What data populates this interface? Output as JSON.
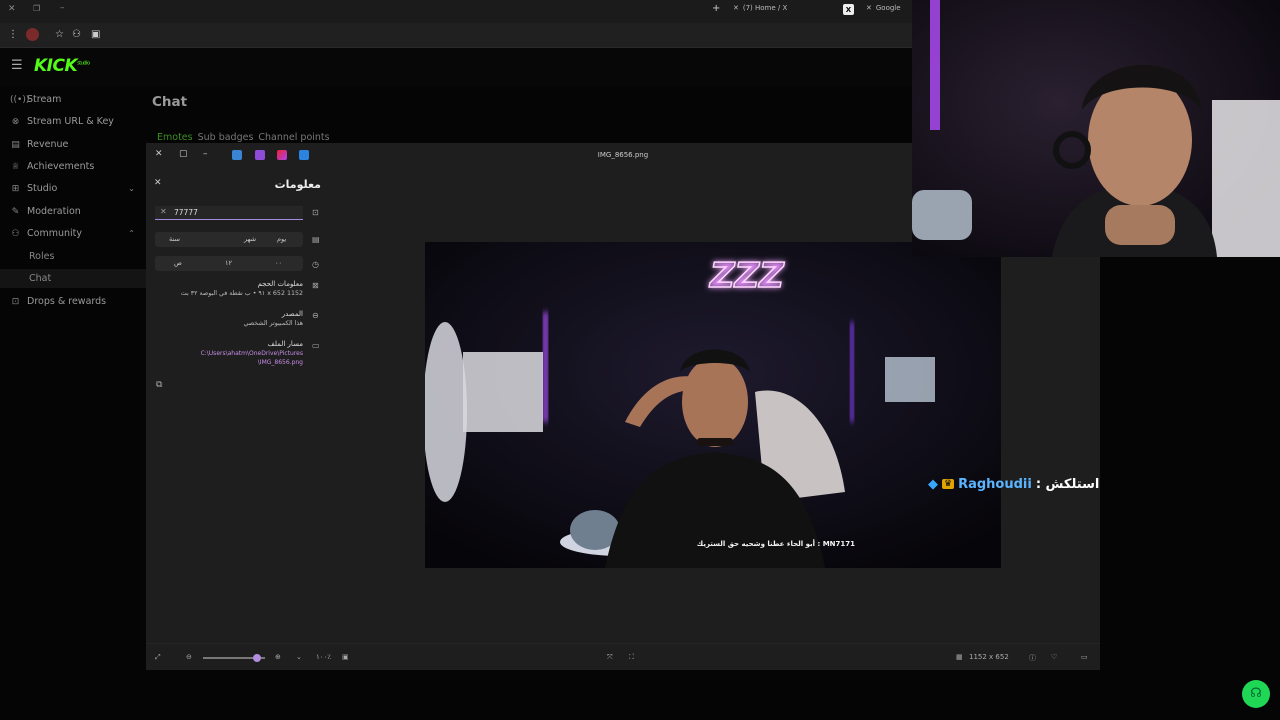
{
  "browser": {
    "tabs": [
      {
        "label": "(7) Home / X",
        "icon": "x-logo-icon"
      },
      {
        "label": "Google",
        "icon": "x-logo-icon"
      }
    ],
    "new_tab_label": "+"
  },
  "kick": {
    "logo": "KICK",
    "logo_badge": "studio",
    "nav": [
      {
        "label": "Stream",
        "icon": "stream-icon"
      },
      {
        "label": "Stream URL & Key",
        "icon": "key-icon"
      },
      {
        "label": "Revenue",
        "icon": "revenue-icon"
      },
      {
        "label": "Achievements",
        "icon": "trophy-icon"
      },
      {
        "label": "Studio",
        "icon": "studio-icon"
      },
      {
        "label": "Moderation",
        "icon": "wrench-icon"
      },
      {
        "label": "Community",
        "icon": "community-icon"
      },
      {
        "label": "Drops & rewards",
        "icon": "gift-icon"
      }
    ],
    "community_sub": [
      "Roles",
      "Chat"
    ],
    "page_title": "Chat",
    "chat_tabs": [
      "Emotes",
      "Sub badges",
      "Channel points"
    ]
  },
  "photos": {
    "title": "IMG_8656.png",
    "info_title": "معلومات",
    "search_value": "77777",
    "date_segments": [
      "يوم",
      "شهر",
      "سنة"
    ],
    "time_segments": [
      "ص",
      "١٢",
      "٠٠"
    ],
    "size_label": "معلومات الحجم",
    "size_value": "1152 x 652 ٩١ • ب نقطة في البوصة ٣٢ بت",
    "source_label": "المصدر",
    "source_value": "هذا الكمبيوتر الشخصي",
    "path_label": "مسار الملف",
    "path_value_1": "C:\\Users\\ahatm\\OneDrive\\Pictures",
    "path_value_2": "\\IMG_8656.png",
    "zoom_label": "١٠٠٪",
    "dimensions": "1152 x 652",
    "photo_caption": "أبو الحاء عطنا وشحيه حق الستريك : MN7171",
    "neon_text": "ZZZ"
  },
  "overlay": {
    "username": "Raghoudii",
    "message": "استلكش :",
    "username_color": "#5ab4ff"
  },
  "colors": {
    "kick_green": "#53fc18",
    "accent": "#b18ddf"
  }
}
